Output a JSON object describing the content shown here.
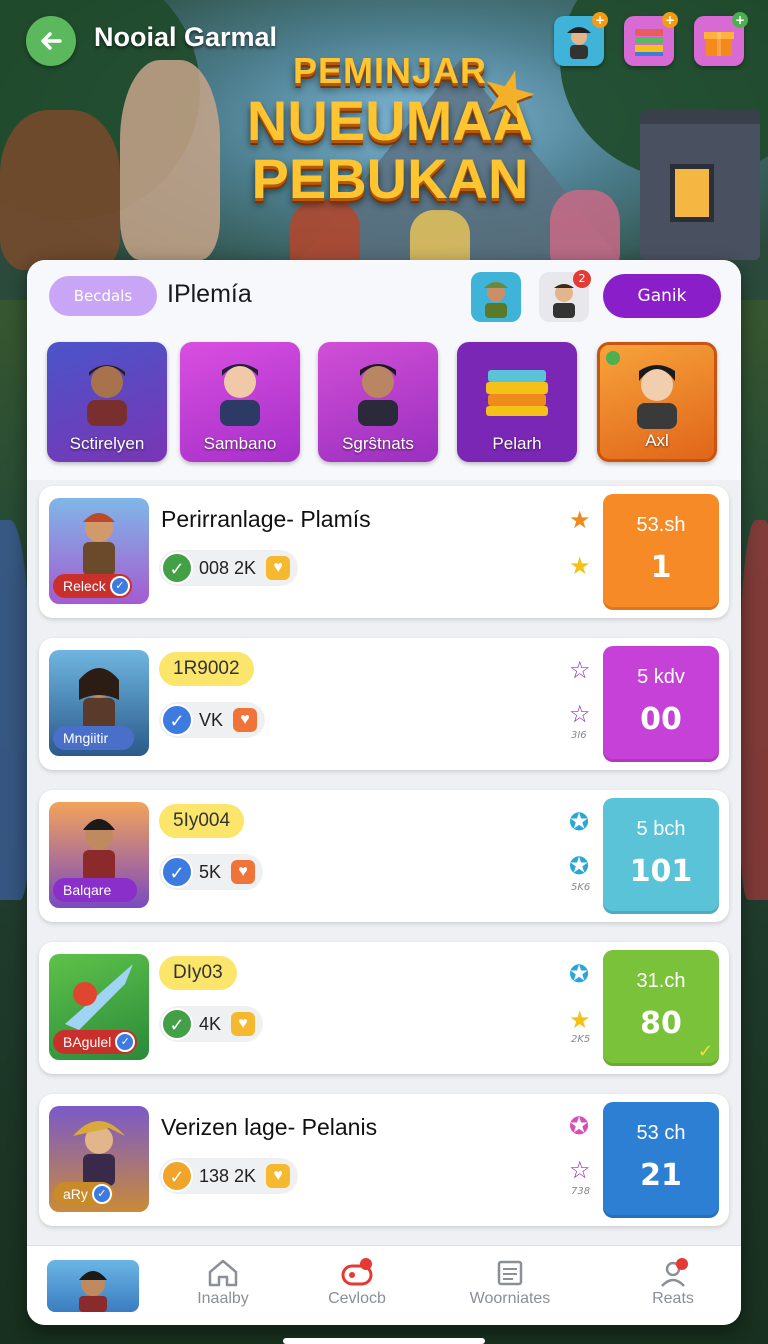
{
  "header": {
    "title": "Nooial Garmal",
    "back_icon": "arrow-left-icon"
  },
  "top_icons": [
    {
      "name": "pirate-avatar-icon",
      "accent": "#f39c12"
    },
    {
      "name": "stack-of-books-icon",
      "accent": "#f39c12"
    },
    {
      "name": "gift-box-icon",
      "accent": "#4caf50"
    }
  ],
  "logo": {
    "line1": "PEMINJAR",
    "line2": "NUEUMAA",
    "line3": "PEBUKAN"
  },
  "panel": {
    "filter_label": "Becdals",
    "title": "IPlemía",
    "avatar_badge": "2",
    "action_label": "Ganik"
  },
  "categories": [
    {
      "label": "Sctirelyen",
      "color": "#6a3fb8"
    },
    {
      "label": "Sambano",
      "color": "#c23fd6"
    },
    {
      "label": "Sgrŝtnats",
      "color": "#b13cc9"
    },
    {
      "label": "Pelarh",
      "color": "#7b27b5"
    },
    {
      "label": "Axl",
      "color": "#ef7f1a"
    }
  ],
  "rows": [
    {
      "title": "Perirranlage- Plamís",
      "code": "",
      "tag": "Releck",
      "stat": "008 2K",
      "check_color": "#43a047",
      "heart_color": "#f5b82e",
      "stars": [
        "#f08a1c",
        "#f5c118"
      ],
      "tiny": "",
      "score_top": "53.sh",
      "score_main": "1",
      "score_color": "#f68a26"
    },
    {
      "title": "",
      "code": "1R9002",
      "tag": "Mngiitir",
      "stat": "VK",
      "check_color": "#3d7be0",
      "heart_color": "#f0733a",
      "stars": [
        "#8e2fc7",
        "#8e2fc7"
      ],
      "tiny": "3I6",
      "score_top": "5 kdv",
      "score_main": "00",
      "score_color": "#c541d8"
    },
    {
      "title": "",
      "code": "5Iy004",
      "tag": "Balqare",
      "stat": "5K",
      "check_color": "#3d7be0",
      "heart_color": "#f0733a",
      "stars": [
        "#2ba6d8",
        "#2ba6d8"
      ],
      "tiny": "5K6",
      "score_top": "5 bch",
      "score_main": "101",
      "score_color": "#5ac3d8"
    },
    {
      "title": "",
      "code": "DIy03",
      "tag": "BAgulel",
      "stat": "4K",
      "check_color": "#43a047",
      "heart_color": "#f5b82e",
      "stars": [
        "#2ba6d8",
        "#f5c118"
      ],
      "tiny": "2K5",
      "score_top": "31.ch",
      "score_main": "80",
      "score_color": "#7bc23b"
    },
    {
      "title": "Verizen lage- Pelanis",
      "code": "",
      "tag": "aRy",
      "stat": "138 2K",
      "check_color": "#f0a42a",
      "heart_color": "#f5b82e",
      "stars": [
        "#d64fb8",
        "#8e2fc7"
      ],
      "tiny": "738",
      "score_top": "53 ch",
      "score_main": "21",
      "score_color": "#2d7fd3"
    }
  ],
  "nav": [
    {
      "label": "",
      "icon": "profile-avatar-icon"
    },
    {
      "label": "Inaalby",
      "icon": "home-icon"
    },
    {
      "label": "Cevlocb",
      "icon": "gamepad-icon",
      "badge": true
    },
    {
      "label": "Woorniates",
      "icon": "newspaper-icon"
    },
    {
      "label": "Reats",
      "icon": "user-icon",
      "badge": true
    }
  ]
}
